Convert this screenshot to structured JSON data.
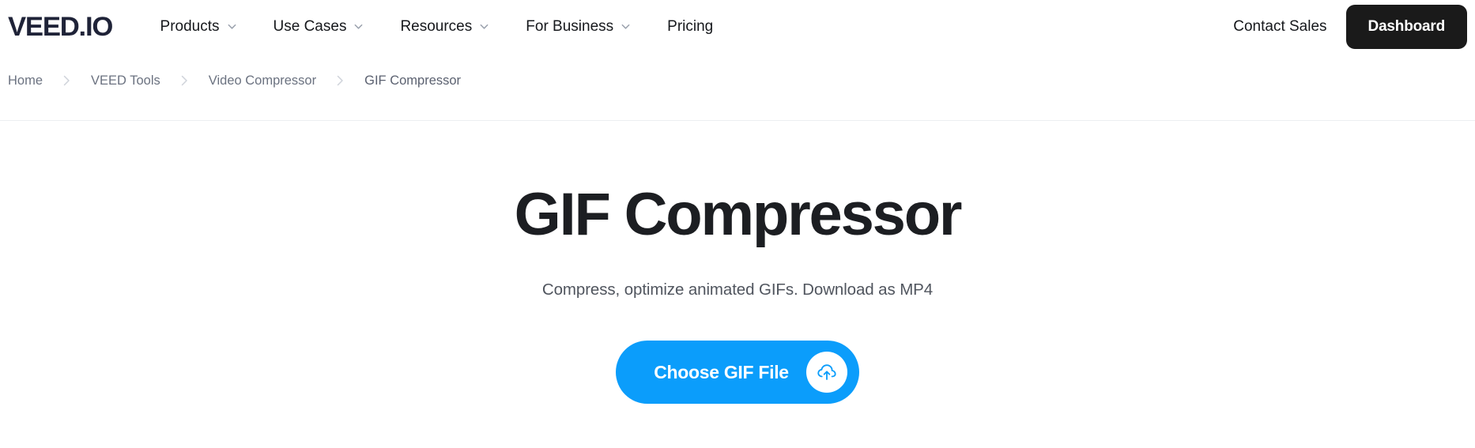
{
  "header": {
    "logo_text": "VEED.IO",
    "nav_items": [
      {
        "label": "Products",
        "has_chevron": true
      },
      {
        "label": "Use Cases",
        "has_chevron": true
      },
      {
        "label": "Resources",
        "has_chevron": true
      },
      {
        "label": "For Business",
        "has_chevron": true
      },
      {
        "label": "Pricing",
        "has_chevron": false
      }
    ],
    "contact_sales_label": "Contact Sales",
    "dashboard_label": "Dashboard"
  },
  "breadcrumb": {
    "separator": "›",
    "items": [
      {
        "label": "Home"
      },
      {
        "label": "VEED Tools"
      },
      {
        "label": "Video Compressor"
      },
      {
        "label": "GIF Compressor"
      }
    ]
  },
  "hero": {
    "title": "GIF Compressor",
    "subtitle": "Compress, optimize animated GIFs. Download as MP4",
    "cta_label": "Choose GIF File",
    "cta_icon": "cloud-upload-icon"
  },
  "colors": {
    "accent_blue": "#0b9dfb",
    "dark_button": "#1a1a1a",
    "logo_navy": "#1f2338",
    "heading": "#1c1e22",
    "muted_text": "#6b7280",
    "divider": "#eceef1"
  }
}
